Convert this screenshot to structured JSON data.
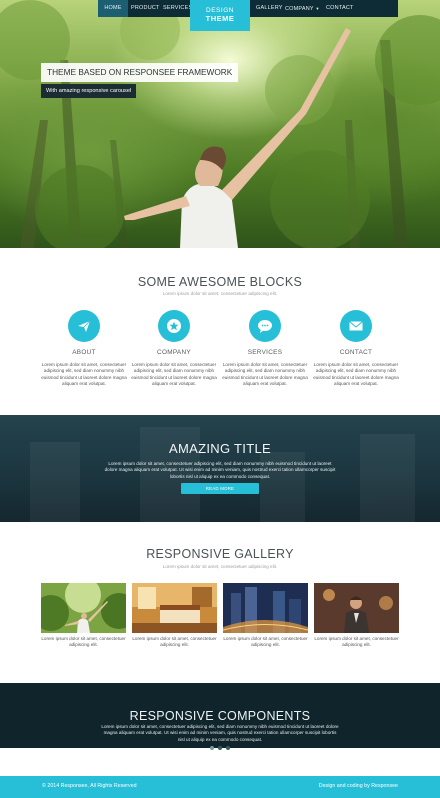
{
  "nav": {
    "items": [
      "HOME",
      "PRODUCT",
      "SERVICES",
      "GALLERY",
      "COMPANY",
      "CONTACT"
    ],
    "logo_line1": "DESIGN",
    "logo_line2": "THEME"
  },
  "hero": {
    "title": "THEME BASED ON RESPONSEE FRAMEWORK",
    "subtitle": "With amazing responsive carousel"
  },
  "blocks": {
    "title": "SOME AWESOME BLOCKS",
    "subtitle": "Lorem ipsum dolor sit amet, consectetuer adipiscing elit.",
    "items": [
      {
        "icon": "paper-plane-icon",
        "title": "ABOUT",
        "text": "Lorem ipsum dolor sit amet, consectetuer adipiscing elit, sed diam nonummy nibh euismod tincidunt ut laoreet dolore magna aliquam erat volutpat."
      },
      {
        "icon": "star-icon",
        "title": "COMPANY",
        "text": "Lorem ipsum dolor sit amet, consectetuer adipiscing elit, sed diam nonummy nibh euismod tincidunt ut laoreet dolore magna aliquam erat volutpat."
      },
      {
        "icon": "chat-icon",
        "title": "SERVICES",
        "text": "Lorem ipsum dolor sit amet, consectetuer adipiscing elit, sed diam nonummy nibh euismod tincidunt ut laoreet dolore magna aliquam erat volutpat."
      },
      {
        "icon": "envelope-icon",
        "title": "CONTACT",
        "text": "Lorem ipsum dolor sit amet, consectetuer adipiscing elit, sed diam nonummy nibh euismod tincidunt ut laoreet dolore magna aliquam erat volutpat."
      }
    ]
  },
  "amazing": {
    "title": "AMAZING TITLE",
    "text": "Lorem ipsum dolor sit amet, consectetuer adipiscing elit, sed diam nonummy nibh euismod tincidunt ut laoreet dolore magna aliquam erat volutpat. Ut wisi enim ad minim veniam, quis nostrud exerci tation ullamcorper suscipit lobortis nisl ut aliquip ex ea commodo consequat.",
    "button": "READ MORE"
  },
  "gallery": {
    "title": "RESPONSIVE GALLERY",
    "subtitle": "Lorem ipsum dolor sit amet, consectetuer adipiscing elit.",
    "items": [
      {
        "caption": "Lorem ipsum dolor sit amet, consectetuer adipiscing elit."
      },
      {
        "caption": "Lorem ipsum dolor sit amet, consectetuer adipiscing elit."
      },
      {
        "caption": "Lorem ipsum dolor sit amet, consectetuer adipiscing elit."
      },
      {
        "caption": "Lorem ipsum dolor sit amet, consectetuer adipiscing elit."
      }
    ]
  },
  "components": {
    "title": "RESPONSIVE COMPONENTS",
    "text": "Lorem ipsum dolor sit amet, consectetuer adipiscing elit, sed diam nonummy nibh euismod tincidunt ut laoreet dolore magna aliquam erat volutpat. Ut wisi enim ad minim veniam, quis nostrud exerci tation ullamcorper suscipit lobortis nisl ut aliquip ex ea commodo consequat.",
    "active_slide": 1,
    "slide_count": 3
  },
  "footer": {
    "copyright": "© 2014 Responsee, All Rights Reserved",
    "credit": "Design and coding by Responsee"
  },
  "colors": {
    "accent": "#27bfd8",
    "nav_bg": "#0e2c35",
    "dark_section": "#10252b"
  }
}
